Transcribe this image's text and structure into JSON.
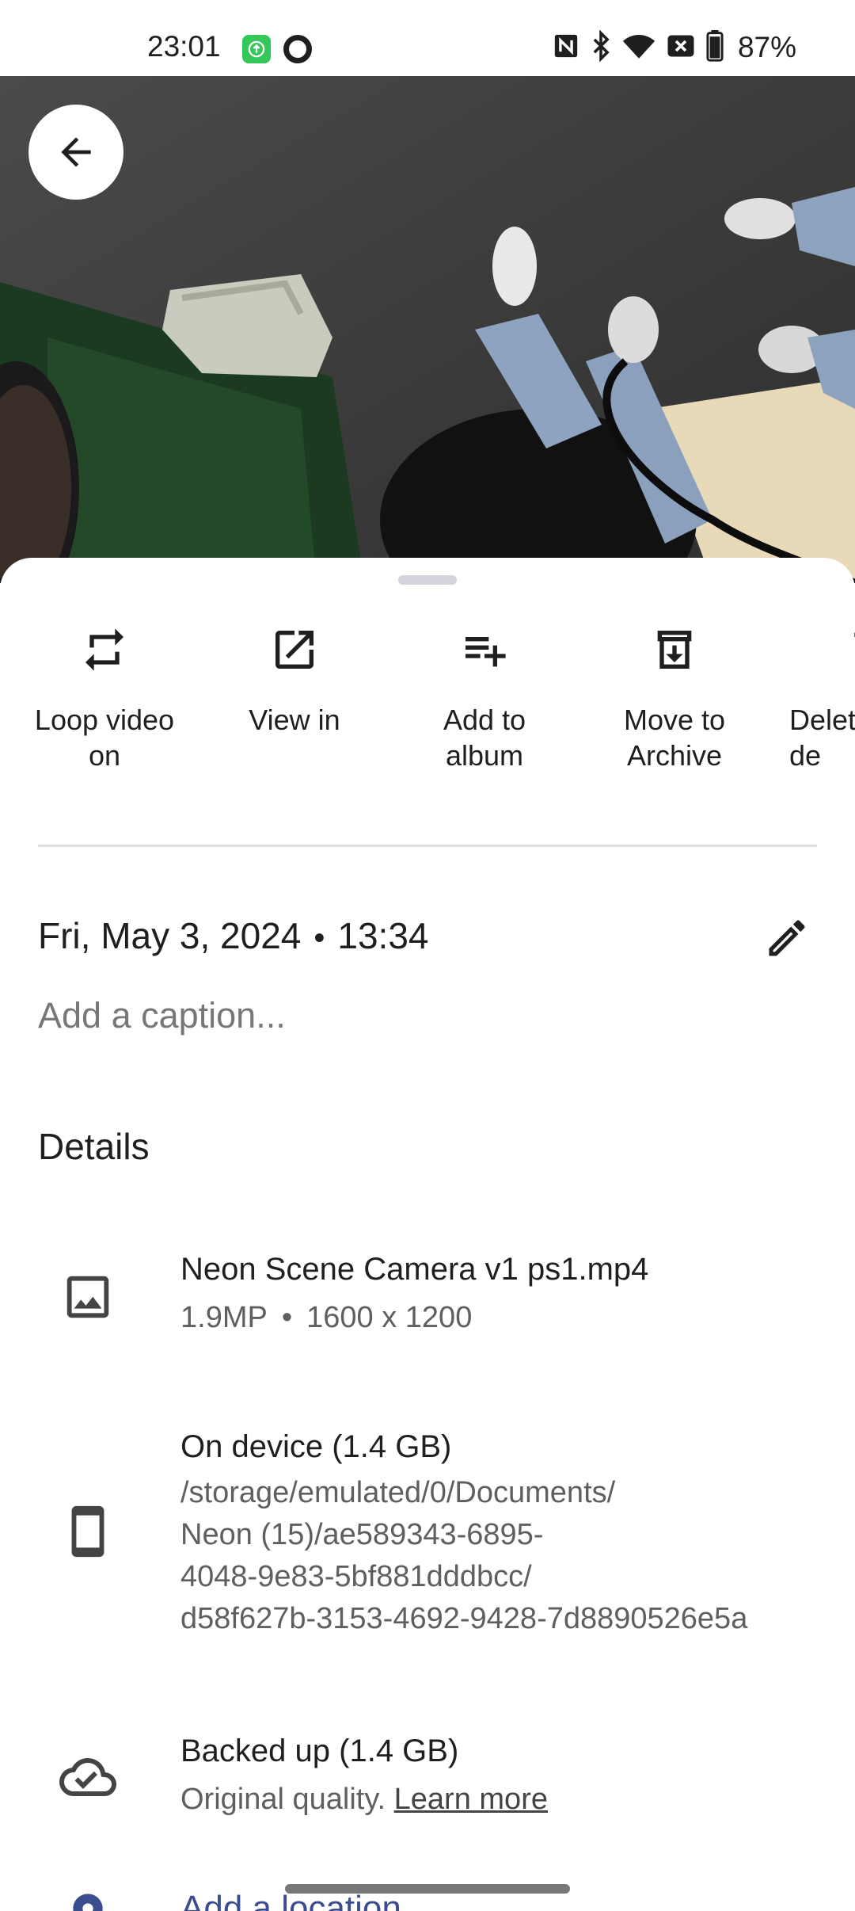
{
  "status_bar": {
    "time": "23:01",
    "battery": "87%"
  },
  "actions": [
    {
      "label": "Loop video\non",
      "icon": "loop-icon"
    },
    {
      "label": "View in",
      "icon": "open-external-icon"
    },
    {
      "label": "Add to\nalbum",
      "icon": "playlist-add-icon"
    },
    {
      "label": "Move to\nArchive",
      "icon": "archive-icon"
    },
    {
      "label": "Delet\nde",
      "icon": "delete-icon"
    }
  ],
  "date": {
    "day": "Fri, May 3, 2024",
    "separator": "•",
    "time": "13:34"
  },
  "caption": {
    "placeholder": "Add a caption..."
  },
  "details": {
    "heading": "Details",
    "file": {
      "name": "Neon Scene Camera v1 ps1.mp4",
      "megapixels": "1.9MP",
      "separator": "•",
      "resolution": "1600 x 1200"
    },
    "storage": {
      "title": "On device (1.4 GB)",
      "path_lines": [
        "/storage/emulated/0/Documents/",
        "Neon (15)/ae589343-6895-",
        "4048-9e83-5bf881dddbcc/",
        "d58f627b-3153-4692-9428-7d8890526e5a"
      ]
    },
    "backup": {
      "title": "Backed up (1.4 GB)",
      "quality": "Original quality.",
      "link": "Learn more"
    },
    "location": {
      "label": "Add a location"
    }
  }
}
